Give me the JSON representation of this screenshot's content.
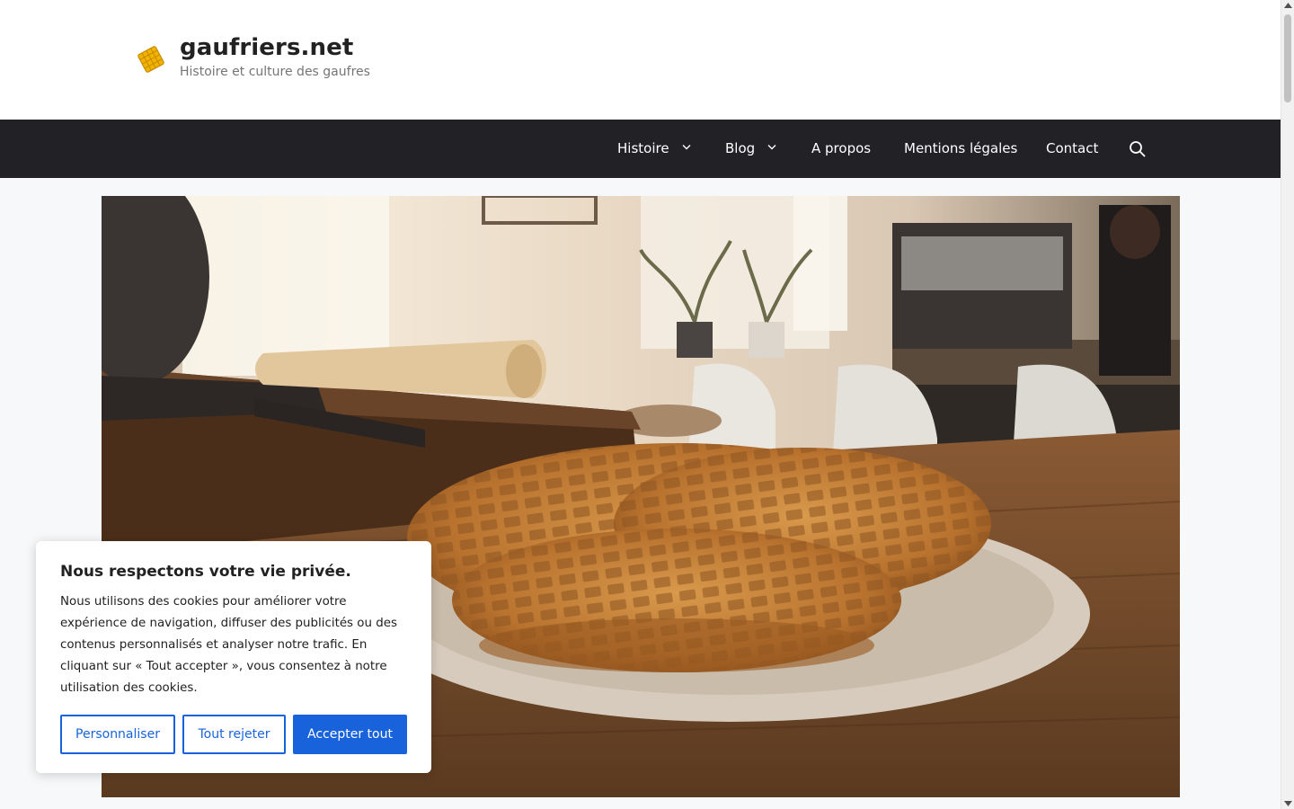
{
  "site": {
    "title": "gaufriers.net",
    "tagline": "Histoire et culture des gaufres"
  },
  "nav": {
    "items": [
      {
        "label": "Histoire",
        "has_dropdown": true
      },
      {
        "label": "Blog",
        "has_dropdown": true
      },
      {
        "label": "A propos",
        "has_dropdown": false
      },
      {
        "label": "Mentions légales",
        "has_dropdown": false
      },
      {
        "label": "Contact",
        "has_dropdown": false
      }
    ],
    "search_icon": "search-icon"
  },
  "hero": {
    "image_subject": "waffles on plate, cast-iron waffle iron and rolled parchment, café background"
  },
  "cookie_banner": {
    "title": "Nous respectons votre vie privée.",
    "text": "Nous utilisons des cookies pour améliorer votre expérience de navigation, diffuser des publicités ou des contenus personnalisés et analyser notre trafic. En cliquant sur « Tout accepter », vous consentez à notre utilisation des cookies.",
    "buttons": {
      "customize": "Personnaliser",
      "reject": "Tout rejeter",
      "accept": "Accepter tout"
    }
  },
  "colors": {
    "nav_bg": "#222226",
    "accent": "#1863dc",
    "logo": "#f0b400"
  }
}
